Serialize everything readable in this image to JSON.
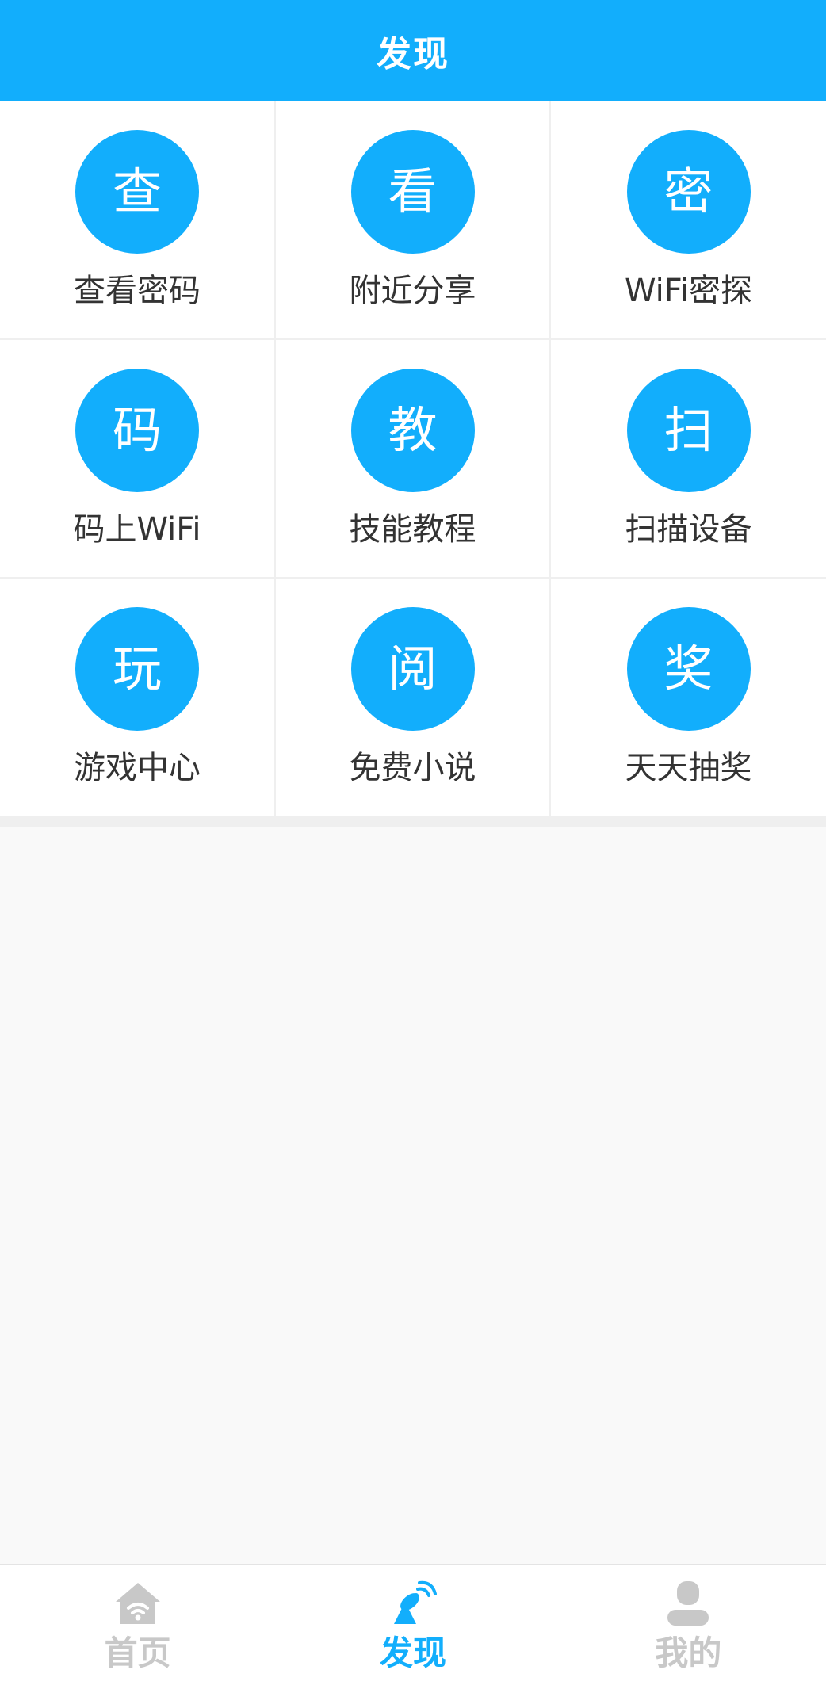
{
  "header": {
    "title": "发现"
  },
  "colors": {
    "accent": "#12aefc",
    "tab_inactive": "#c8c8c8",
    "label_text": "#333333"
  },
  "grid": {
    "items": [
      {
        "glyph": "查",
        "label": "查看密码"
      },
      {
        "glyph": "看",
        "label": "附近分享"
      },
      {
        "glyph": "密",
        "label": "WiFi密探"
      },
      {
        "glyph": "码",
        "label": "码上WiFi"
      },
      {
        "glyph": "教",
        "label": "技能教程"
      },
      {
        "glyph": "扫",
        "label": "扫描设备"
      },
      {
        "glyph": "玩",
        "label": "游戏中心"
      },
      {
        "glyph": "阅",
        "label": "免费小说"
      },
      {
        "glyph": "奖",
        "label": "天天抽奖"
      }
    ]
  },
  "tabbar": {
    "tabs": [
      {
        "label": "首页",
        "icon": "home-wifi-icon",
        "active": false
      },
      {
        "label": "发现",
        "icon": "satellite-dish-icon",
        "active": true
      },
      {
        "label": "我的",
        "icon": "user-icon",
        "active": false
      }
    ]
  }
}
